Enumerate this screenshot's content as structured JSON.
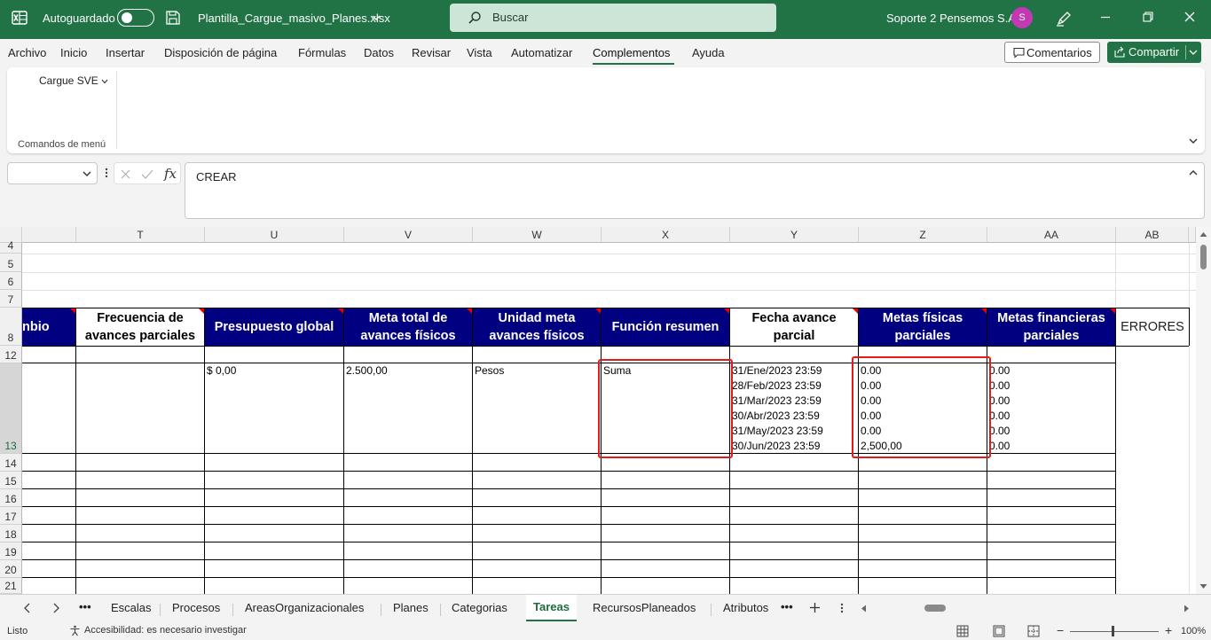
{
  "title_bar": {
    "autosave_label": "Autoguardado",
    "filename": "Plantilla_Cargue_masivo_Planes.xlsx",
    "search_placeholder": "Buscar",
    "user_name": "Soporte 2 Pensemos S.A.",
    "avatar_initial": "S",
    "accent_color": "#217346"
  },
  "menu": {
    "items": [
      "Archivo",
      "Inicio",
      "Insertar",
      "Disposición de página",
      "Fórmulas",
      "Datos",
      "Revisar",
      "Vista",
      "Automatizar",
      "Complementos",
      "Ayuda"
    ],
    "active": "Complementos",
    "comments_label": "Comentarios",
    "share_label": "Compartir"
  },
  "ribbon": {
    "button_label": "Cargue SVE",
    "group_label": "Comandos de menú"
  },
  "formula_bar": {
    "name_box": "",
    "fx_label": "fx",
    "formula": "CREAR"
  },
  "columns": [
    {
      "letter": "T"
    },
    {
      "letter": "U"
    },
    {
      "letter": "V"
    },
    {
      "letter": "W"
    },
    {
      "letter": "X"
    },
    {
      "letter": "Y"
    },
    {
      "letter": "Z"
    },
    {
      "letter": "AA"
    },
    {
      "letter": "AB"
    }
  ],
  "rows": [
    "4",
    "5",
    "6",
    "7",
    "8",
    "12",
    "13",
    "14",
    "15",
    "16",
    "17",
    "18",
    "19",
    "20",
    "21"
  ],
  "headers": {
    "S": "nbio",
    "T": "Frecuencia de avances parciales",
    "U": "Presupuesto global",
    "V": "Meta total de avances físicos",
    "W": "Unidad meta avances físicos",
    "X": "Función resumen",
    "Y": "Fecha avance parcial",
    "Z": "Metas físicas parciales",
    "AA": "Metas financieras parciales",
    "AB": "ERRORES"
  },
  "row13": {
    "U": "$ 0,00",
    "V": "2.500,00",
    "W": "Pesos",
    "X": "Suma",
    "Y": [
      "31/Ene/2023 23:59",
      "28/Feb/2023 23:59",
      "31/Mar/2023 23:59",
      "30/Abr/2023 23:59",
      "31/May/2023 23:59",
      "30/Jun/2023 23:59"
    ],
    "Z": [
      "0.00",
      "0.00",
      "0.00",
      "0.00",
      "0.00",
      "2,500,00"
    ],
    "AA": [
      "0.00",
      "0.00",
      "0.00",
      "0.00",
      "0.00",
      "0.00"
    ]
  },
  "sheet_tabs": {
    "items": [
      "Escalas",
      "Procesos",
      "AreasOrganizacionales",
      "Planes",
      "Categorias",
      "Tareas",
      "RecursosPlaneados",
      "Atributos"
    ],
    "active": "Tareas",
    "more": "•••"
  },
  "status_bar": {
    "ready": "Listo",
    "accessibility": "Accesibilidad: es necesario investigar",
    "zoom": "100%"
  }
}
